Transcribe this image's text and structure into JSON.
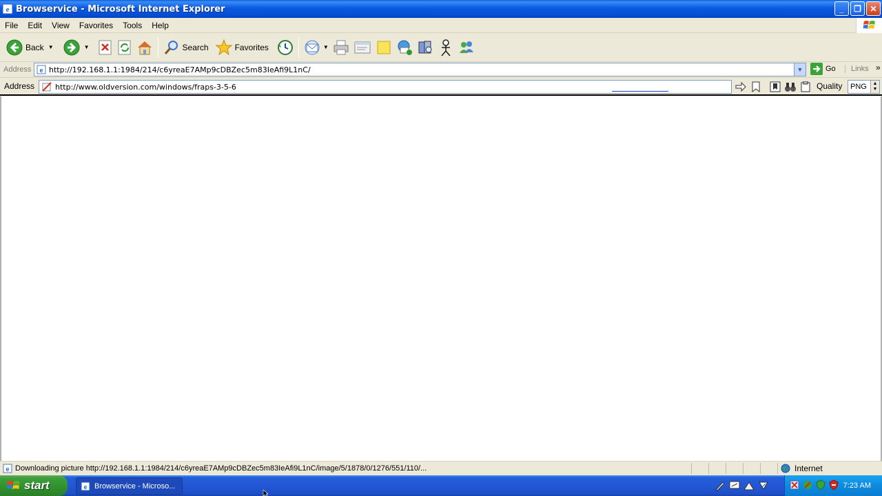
{
  "window": {
    "title": "Browservice - Microsoft Internet Explorer",
    "buttons": {
      "minimize": "_",
      "maximize": "❐",
      "close": "✕"
    }
  },
  "menu": [
    "File",
    "Edit",
    "View",
    "Favorites",
    "Tools",
    "Help"
  ],
  "toolbar": {
    "back_label": "Back",
    "search_label": "Search",
    "favorites_label": "Favorites"
  },
  "address_bar": {
    "label": "Address",
    "url": "http://192.168.1.1:1984/214/c6yreaE7AMp9cDBZec5m83IeAfi9L1nC/",
    "go_label": "Go",
    "links_label": "Links"
  },
  "inner_bar": {
    "label": "Address",
    "url": "http://www.oldversion.com/windows/fraps-3-5-6",
    "quality_label": "Quality",
    "format_value": "PNG"
  },
  "status_bar": {
    "text": "Downloading picture http://192.168.1.1:1984/214/c6yreaE7AMp9cDBZec5m83IeAfi9L1nC/image/5/1878/0/1276/551/110/...",
    "zone": "Internet"
  },
  "taskbar": {
    "start_label": "start",
    "task_label": "Browservice - Microso...",
    "clock": "7:23 AM"
  }
}
